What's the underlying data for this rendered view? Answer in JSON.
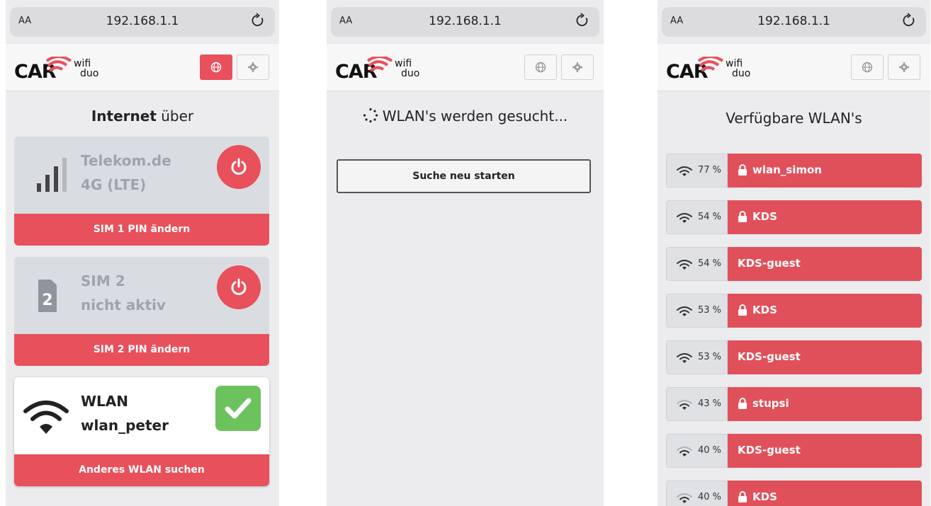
{
  "url": "192.168.1.1",
  "url_aa": "AA",
  "logo": {
    "brand": "CAR",
    "wifi": "wifi",
    "duo": "duo"
  },
  "colors": {
    "accent": "#e8505b",
    "success": "#6cc25d",
    "card_gray": "#d9dde2"
  },
  "screen1": {
    "title_bold": "Internet",
    "title_rest": "über",
    "cards": [
      {
        "line1": "Telekom.de",
        "line2": "4G (LTE)",
        "icon": "cellular-signal-icon",
        "action_icon": "power-icon",
        "footer": "SIM 1 PIN ändern"
      },
      {
        "line1": "SIM 2",
        "line2": "nicht aktiv",
        "icon": "sim-card-icon",
        "sim_number": "2",
        "action_icon": "power-icon",
        "footer": "SIM 2 PIN ändern"
      },
      {
        "line1": "WLAN",
        "line2": "wlan_peter",
        "icon": "wifi-icon",
        "action_icon": "checkmark-icon",
        "footer": "Anderes WLAN suchen"
      }
    ]
  },
  "screen2": {
    "status": "WLAN's werden gesucht...",
    "restart_button": "Suche neu starten"
  },
  "screen3": {
    "title": "Verfügbare WLAN's",
    "networks": [
      {
        "signal": "77 %",
        "name": "wlan_simon",
        "locked": true
      },
      {
        "signal": "54 %",
        "name": "KDS",
        "locked": true
      },
      {
        "signal": "54 %",
        "name": "KDS-guest",
        "locked": false
      },
      {
        "signal": "53 %",
        "name": "KDS",
        "locked": true
      },
      {
        "signal": "53 %",
        "name": "KDS-guest",
        "locked": false
      },
      {
        "signal": "43 %",
        "name": "stupsi",
        "locked": true
      },
      {
        "signal": "40 %",
        "name": "KDS-guest",
        "locked": false
      },
      {
        "signal": "40 %",
        "name": "KDS",
        "locked": true
      }
    ]
  }
}
